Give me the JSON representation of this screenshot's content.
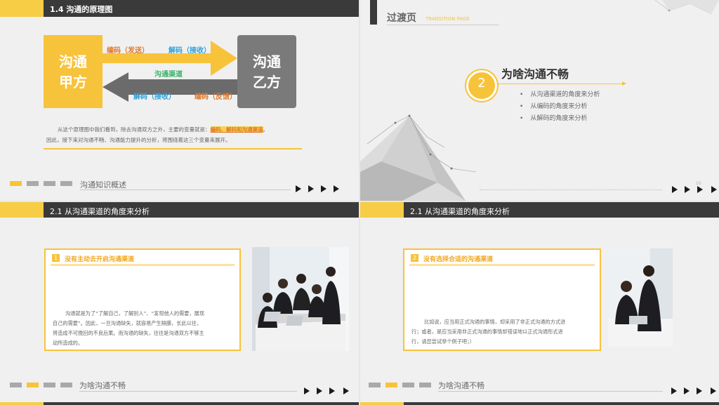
{
  "slide1": {
    "header_title": "1.4 沟通的原理图",
    "box_left": [
      "沟通",
      "甲方"
    ],
    "box_right": [
      "沟通",
      "乙方"
    ],
    "encode_send": "编码（发送）",
    "decode_receive_top": "解码（接收）",
    "channel": "沟通渠道",
    "decode_receive_bottom": "解码（接收）",
    "encode_feedback": "编码（反馈）",
    "para_part1": "从这个原理图中我们看到，除去沟通双方之外，主要的变量就是：",
    "para_highlight": "编码、解码和沟通渠道",
    "para_end": "。",
    "para_line2": "因此，接下来对沟通不畅、沟通能力提升的分析，将围绕着这三个变量来展开。",
    "footer_label": "沟通知识概述",
    "colors": {
      "yellow": "#f7c33a",
      "gray_box": "#7a7a7a",
      "dark_arrow": "#6b6b6b"
    }
  },
  "slide2": {
    "title": "过渡页",
    "subtitle": "TRANSITION PAGE",
    "number": "2",
    "heading": "为啥沟通不畅",
    "bullets": [
      "从沟通渠道的角度来分析",
      "从编码的角度来分析",
      "从解码的角度来分析"
    ],
    "page_num": "10"
  },
  "slide3": {
    "header_title": "2.1 从沟通渠道的角度来分析",
    "box_number": "1",
    "box_title": "没有主动去开启沟通渠道",
    "body_lines": [
      "沟通就是为了“了解自己，了解别人”、“发现他人的需要，展现",
      "自己的需要”。因此，一旦沟通缺失，就容易产生隔膜，长此以往，",
      "将造成不可挽回的不良后果。而沟通的缺失，往往是沟通双方不够主",
      "动所造成的。"
    ],
    "footer_label": "为啥沟通不畅"
  },
  "slide4": {
    "header_title": "2.1 从沟通渠道的角度来分析",
    "box_number": "2",
    "box_title": "没有选择合适的沟通渠道",
    "body_lines": [
      "比如说，应当用正式沟通的事情，却采用了非正式沟通的方式进",
      "行；或者，是应当采用非正式沟通的事情却错误地以正式沟通形式进",
      "行，请您尝试举个例子吧；）"
    ],
    "footer_label": "为啥沟通不畅"
  }
}
